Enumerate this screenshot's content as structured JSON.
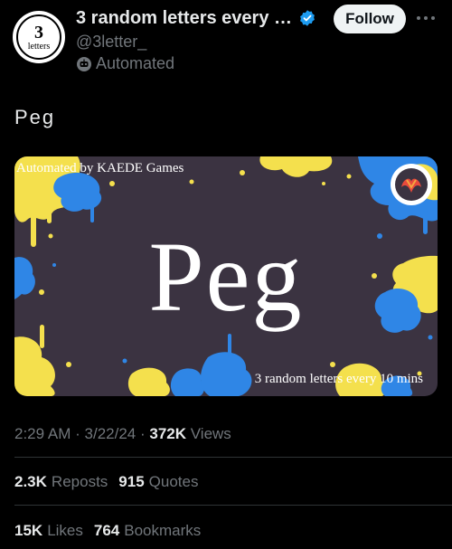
{
  "author": {
    "avatar_number": "3",
    "avatar_word": "letters",
    "display_name": "3 random letters every 10...",
    "handle": "@3letter_",
    "automated_label": "Automated"
  },
  "actions": {
    "follow_label": "Follow"
  },
  "tweet": {
    "text": "Peg"
  },
  "media": {
    "word": "Peg",
    "top_caption": "Automated by KAEDE Games",
    "bottom_caption": "3 random letters every 10 mins"
  },
  "meta": {
    "time": "2:29 AM",
    "date": "3/22/24",
    "views_count": "372K",
    "views_label": "Views",
    "separator": "·"
  },
  "stats": {
    "reposts_count": "2.3K",
    "reposts_label": "Reposts",
    "quotes_count": "915",
    "quotes_label": "Quotes",
    "likes_count": "15K",
    "likes_label": "Likes",
    "bookmarks_count": "764",
    "bookmarks_label": "Bookmarks"
  },
  "colors": {
    "background": "#000000",
    "text_primary": "#e7e9ea",
    "text_secondary": "#71767b",
    "verified_blue": "#1d9bf0",
    "splat_yellow": "#f4e04d",
    "splat_blue": "#2f86e6",
    "media_bg": "#3b3341"
  },
  "icons": {
    "verified": "verified-badge-icon",
    "automated": "bot-icon",
    "more": "more-horizontal-icon"
  }
}
